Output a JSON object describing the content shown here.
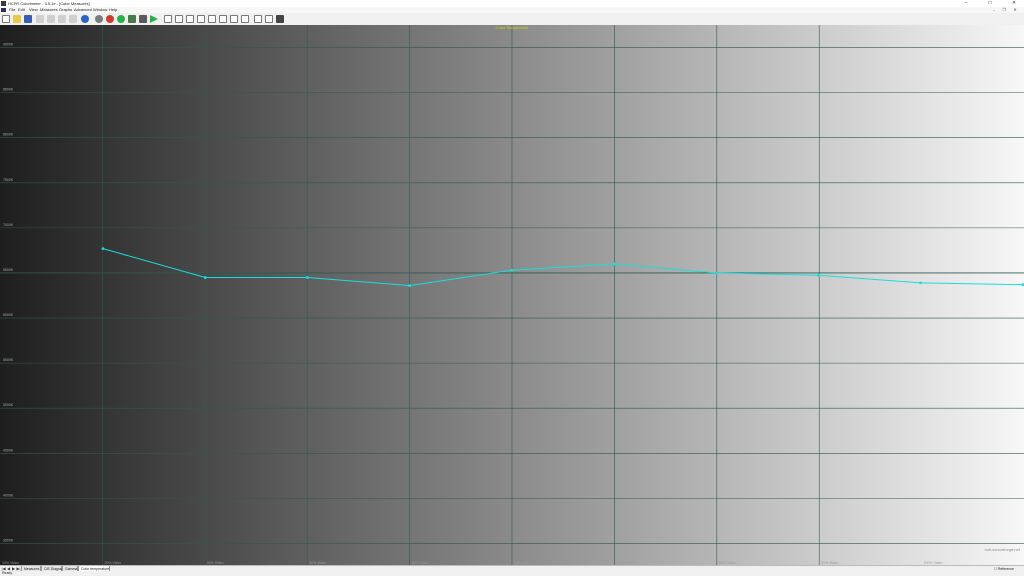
{
  "window": {
    "title": "HCFR Colorimeter - 3.5.1e - [Color Measures]",
    "controls": {
      "minimize": "–",
      "maximize": "□",
      "close": "✕"
    }
  },
  "menu": {
    "items": [
      "File",
      "Edit",
      "View",
      "Measures",
      "Graphs",
      "Advanced",
      "Window",
      "Help"
    ],
    "mdi_controls": {
      "minimize": "–",
      "restore": "❐",
      "close": "✕"
    }
  },
  "toolbar": {
    "icons": [
      "new-icon",
      "open-icon",
      "save-icon",
      "cut-icon",
      "copy-icon",
      "paste-icon",
      "print-icon",
      "help-icon",
      "color-bubbles-icon",
      "rgb-icon",
      "measure-icon",
      "display-icon",
      "sensor-icon",
      "play-icon",
      "doc-icon-1",
      "doc-icon-2",
      "doc-icon-3",
      "doc-icon-4",
      "doc-icon-5",
      "doc-icon-6",
      "doc-icon-7",
      "doc-icon-8",
      "doc-icon-9",
      "doc-icon-10",
      "doc-icon-11"
    ],
    "colors": {
      "accent_green": "#29b04a",
      "accent_blue": "#2b63c4",
      "accent_red": "#d23b2b"
    }
  },
  "chart_data": {
    "type": "line",
    "title": "Color Temperature",
    "categories": [
      "10% Video",
      "20% Video",
      "30% Video",
      "40% Video",
      "50% Video",
      "60% Video",
      "70% Video",
      "80% Video",
      "90% Video",
      "100% Video"
    ],
    "ylabels": [
      "9000K",
      "8500K",
      "8000K",
      "7500K",
      "7000K",
      "6500K",
      "6000K",
      "5500K",
      "5000K",
      "4500K",
      "4000K",
      "3500K"
    ],
    "ylim": [
      3250,
      9250
    ],
    "reference_K": 6500,
    "series": [
      {
        "values": [
          6770,
          6450,
          6450,
          6360,
          6530,
          6600,
          6500,
          6475,
          6390,
          6370
        ],
        "color": "#19dede"
      }
    ],
    "background_gradient": [
      "#1e1e1e",
      "#f7f7f7"
    ],
    "grid_color": "#2e5a52",
    "title_color": "#d8d000",
    "watermark": "hcfr.sourceforge.net"
  },
  "tabs": {
    "items": [
      "Measures",
      "CIE Diagram",
      "Gamma",
      "Color temperature"
    ],
    "active": "Color temperature",
    "nav": [
      "|◀",
      "◀",
      "▶",
      "▶|"
    ]
  },
  "reference": {
    "label": "Reference"
  },
  "status": {
    "text": "Ready"
  }
}
